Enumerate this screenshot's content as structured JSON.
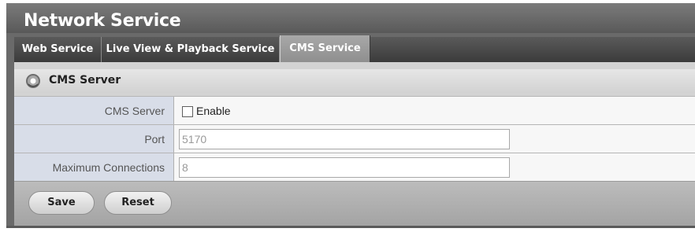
{
  "page": {
    "title": "Network Service"
  },
  "tabs": [
    {
      "label": "Web Service",
      "active": false
    },
    {
      "label": "Live View & Playback Service",
      "active": false
    },
    {
      "label": "CMS Service",
      "active": true
    }
  ],
  "section": {
    "title": "CMS Server",
    "icon": "gear-icon"
  },
  "form": {
    "cms_server": {
      "label": "CMS Server",
      "checkbox_label": "Enable",
      "checked": false
    },
    "port": {
      "label": "Port",
      "value": "5170"
    },
    "max_connections": {
      "label": "Maximum Connections",
      "value": "8"
    }
  },
  "buttons": {
    "save": "Save",
    "reset": "Reset"
  },
  "colors": {
    "title_bar": "#6a6a6a",
    "tab_bar": "#444444",
    "active_tab": "#9a9a9a",
    "label_cell": "#d8dde8",
    "value_cell": "#f7f7f7"
  }
}
